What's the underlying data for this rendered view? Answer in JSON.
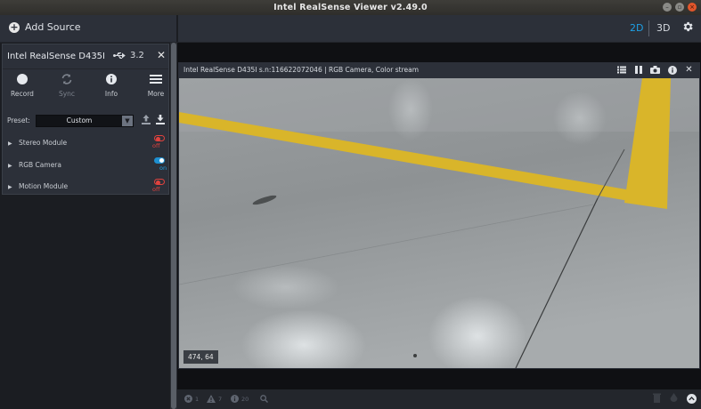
{
  "window": {
    "title": "Intel RealSense Viewer v2.49.0",
    "controls": [
      "minimize-icon",
      "maximize-icon",
      "close-icon"
    ]
  },
  "toolbar": {
    "add_source_label": "Add Source",
    "view_2d": "2D",
    "view_3d": "3D",
    "active_view": "2D",
    "accent_color": "#1ea1e6"
  },
  "device": {
    "name": "Intel RealSense D435I",
    "usb_version": "3.2",
    "actions": [
      {
        "label": "Record",
        "icon": "record-icon",
        "enabled": true
      },
      {
        "label": "Sync",
        "icon": "sync-icon",
        "enabled": false
      },
      {
        "label": "Info",
        "icon": "info-icon",
        "enabled": true
      },
      {
        "label": "More",
        "icon": "menu-icon",
        "enabled": true
      }
    ],
    "preset_label": "Preset:",
    "preset_value": "Custom",
    "modules": [
      {
        "name": "Stereo Module",
        "state": "off"
      },
      {
        "name": "RGB Camera",
        "state": "on"
      },
      {
        "name": "Motion Module",
        "state": "off"
      }
    ]
  },
  "stream": {
    "title": "Intel RealSense D435I s.n:116622072046 | RGB Camera, Color stream",
    "cursor_readout": "474, 64",
    "header_icons": [
      "list-icon",
      "pause-icon",
      "snapshot-icon",
      "info-icon",
      "close-icon"
    ]
  },
  "statusbar": {
    "error_count": "1",
    "warning_count": "7",
    "info_count": "20"
  }
}
